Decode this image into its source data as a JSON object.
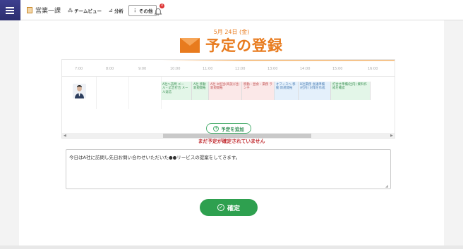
{
  "header": {
    "org_name": "営業一課",
    "nav": [
      {
        "label": "チームビュー",
        "icon": "team-icon"
      },
      {
        "label": "分析",
        "icon": "chart-icon"
      },
      {
        "label": "その他",
        "icon": "more-icon"
      }
    ],
    "notification_count": "4"
  },
  "page": {
    "date": "5月 24日 (金)",
    "title": "予定の登録"
  },
  "schedule": {
    "times": [
      "7:00",
      "8:00",
      "9:00",
      "10:00",
      "11:00",
      "12:00",
      "13:00",
      "14:00",
      "15:00",
      "16:00"
    ],
    "events": [
      {
        "text": "A社へ訪問 メール・広告打合 メール返信",
        "color": "green"
      },
      {
        "text": "A社 移動 新規開拓",
        "color": "green"
      },
      {
        "text": "A社 ※担当(商談)(社) 新規開拓",
        "color": "red"
      },
      {
        "text": "移動・昼食・業務 ランチ",
        "color": "red"
      },
      {
        "text": "オフィスへ 移動 新規開拓",
        "color": "blue"
      },
      {
        "text": "B社業務 会議準備(社内) 対策を作成",
        "color": "blue"
      },
      {
        "text": "打合せ準備(社内) 資料作成を確認",
        "color": "green"
      }
    ]
  },
  "actions": {
    "add_label": "予定を追加",
    "warning": "まだ予定が確定されていません",
    "memo_value": "今日はA社に訪問し先日お問い合わせいただいた●●リービスの提案をしてきます。",
    "confirm_label": "確定"
  },
  "colors": {
    "accent": "#e87b1e",
    "confirm": "#2ea04f",
    "warning": "#c0282d"
  }
}
